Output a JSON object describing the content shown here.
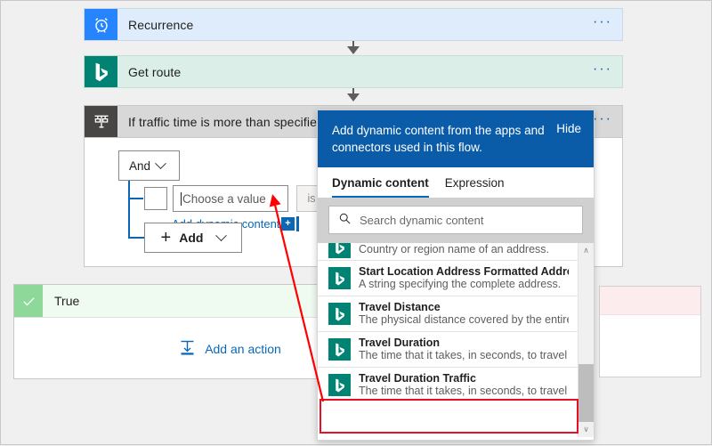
{
  "flow": {
    "steps": [
      {
        "title": "Recurrence",
        "icon": "alarm-clock-icon",
        "menu": "···",
        "accent": "#2684ff",
        "body": "#deecfc"
      },
      {
        "title": "Get route",
        "icon": "bing-maps-icon",
        "menu": "···",
        "accent": "#018374",
        "body": "#dceee8"
      },
      {
        "title": "If traffic time is more than specified",
        "icon": "condition-icon",
        "menu": "···",
        "accent": "#484644",
        "body": "#d8d8d8"
      }
    ]
  },
  "condition": {
    "operator_label": "And",
    "operator_chevron": "chevron-down-icon",
    "value_placeholder": "Choose a value",
    "operator_is": "is",
    "add_dynamic_content_link": "Add dynamic content",
    "dynamic_badge": "+",
    "add_button_label": "Add",
    "add_button_plus": "+"
  },
  "branches": {
    "true_label": "True",
    "true_check": "checkmark-icon",
    "add_action_label": "Add an action",
    "add_action_icon": "add-action-icon"
  },
  "dynamic_panel": {
    "banner_text": "Add dynamic content from the apps and connectors used in this flow.",
    "hide_label": "Hide",
    "tabs": [
      {
        "label": "Dynamic content",
        "active": true
      },
      {
        "label": "Expression",
        "active": false
      }
    ],
    "search_placeholder": "Search dynamic content",
    "search_icon": "search-icon",
    "scrollbar": {
      "up": "∧",
      "down": "∨"
    },
    "items": [
      {
        "name": "",
        "desc": "Country or region name of an address.",
        "icon": "bing-maps-icon",
        "clipped": true,
        "highlighted": false
      },
      {
        "name": "Start Location Address Formatted Address",
        "desc": "A string specifying the complete address.",
        "icon": "bing-maps-icon",
        "clipped": false,
        "highlighted": false
      },
      {
        "name": "Travel Distance",
        "desc": "The physical distance covered by the entire",
        "icon": "bing-maps-icon",
        "clipped": false,
        "highlighted": false
      },
      {
        "name": "Travel Duration",
        "desc": "The time that it takes, in seconds, to travel ...",
        "icon": "bing-maps-icon",
        "clipped": false,
        "highlighted": false
      },
      {
        "name": "Travel Duration Traffic",
        "desc": "The time that it takes, in seconds, to travel ...",
        "icon": "bing-maps-icon",
        "clipped": false,
        "highlighted": true
      }
    ]
  },
  "annotations": {
    "highlight_color": "#e81123",
    "arrow_color": "#ff0000"
  }
}
